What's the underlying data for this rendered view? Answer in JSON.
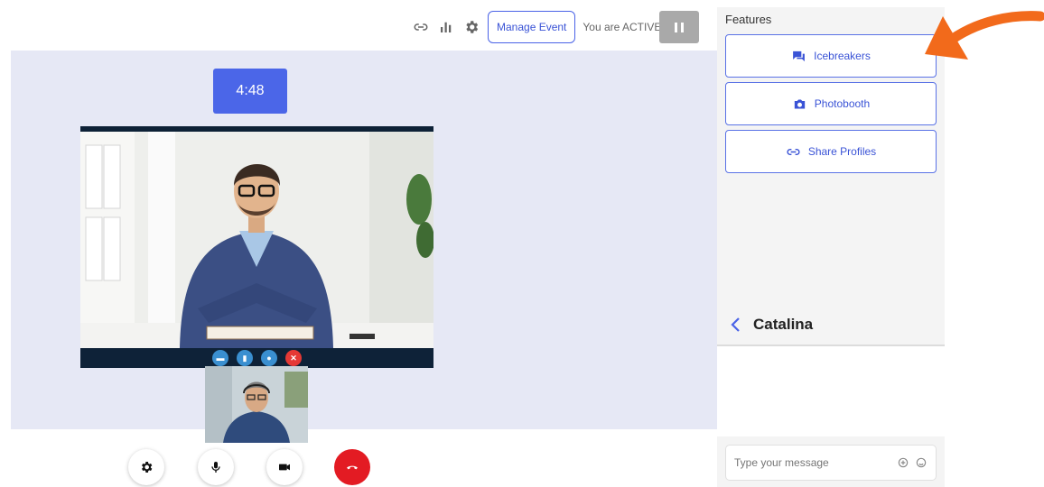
{
  "toolbar": {
    "icons": [
      "link-icon",
      "bar-chart-icon",
      "gear-icon"
    ],
    "manage_label": "Manage Event",
    "status": "You are ACTIVE",
    "pause_icon": "pause-icon"
  },
  "stage": {
    "timer": "4:48",
    "video_actions": [
      "chat-icon",
      "signal-icon",
      "message-icon",
      "close-icon"
    ]
  },
  "controls": {
    "items": [
      "gear-icon",
      "microphone-icon",
      "camera-icon",
      "hang-up-icon"
    ],
    "end_call_color": "#e31b23"
  },
  "panel": {
    "title": "Features",
    "features": [
      {
        "label": "Icebreakers",
        "icon": "chat-bubbles-icon"
      },
      {
        "label": "Photobooth",
        "icon": "camera-icon"
      },
      {
        "label": "Share Profiles",
        "icon": "link-icon"
      }
    ],
    "chat": {
      "name": "Catalina",
      "placeholder": "Type your message"
    }
  },
  "colors": {
    "accent": "#4b66e8",
    "stage_bg": "#e6e8f5",
    "arrow": "#f26a1b"
  }
}
